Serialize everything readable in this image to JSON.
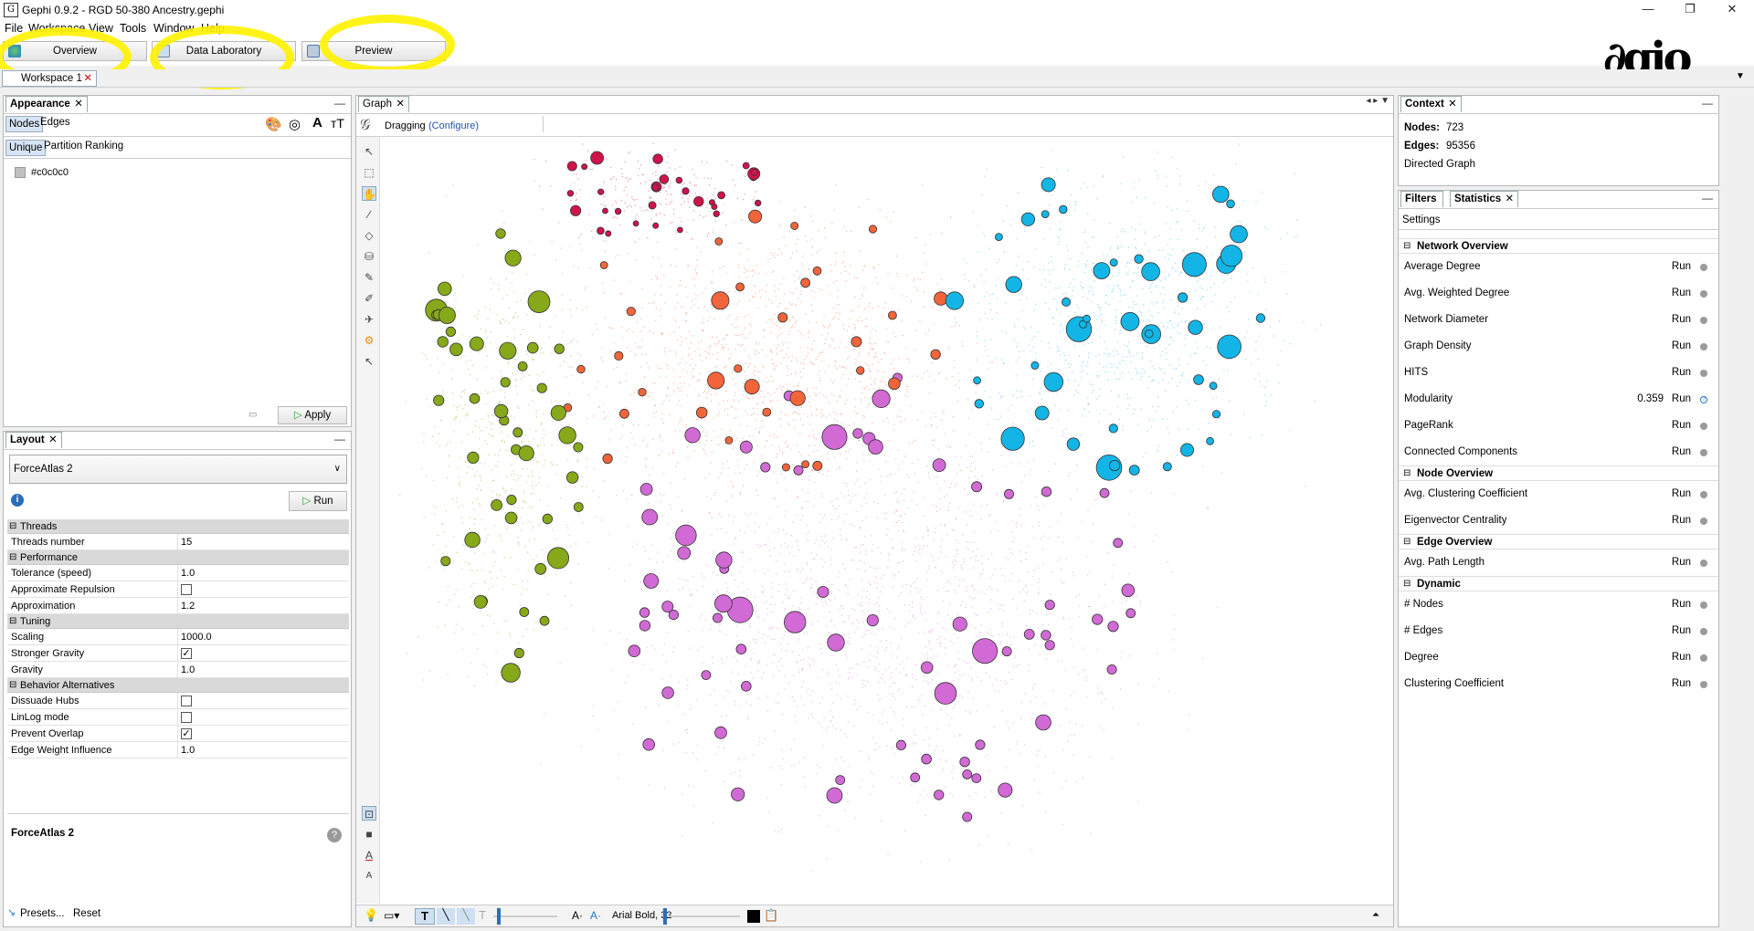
{
  "window": {
    "title": "Gephi 0.9.2 - RGD 50-380 Ancestry.gephi",
    "app_icon": "G",
    "controls": [
      "—",
      "❐",
      "✕"
    ]
  },
  "menu": [
    "File",
    "Workspace",
    "View",
    "Tools",
    "Window",
    "Help"
  ],
  "toolbar": {
    "overview": "Overview",
    "data_lab": "Data Laboratory",
    "preview": "Preview",
    "logo": "∂gio"
  },
  "workspace_tab": "Workspace 1",
  "appearance": {
    "tab": "Appearance",
    "subtabs": [
      "Nodes",
      "Edges"
    ],
    "modes": [
      "Unique",
      "Partition",
      "Ranking"
    ],
    "color_value": "#c0c0c0",
    "apply_label": "Apply",
    "icons": [
      "palette-icon",
      "size-icon",
      "label-color-icon",
      "label-size-icon"
    ]
  },
  "layout": {
    "tab": "Layout",
    "algorithm": "ForceAtlas 2",
    "run_label": "Run",
    "sections": [
      {
        "name": "Threads",
        "props": [
          {
            "name": "Threads number",
            "value": "15"
          }
        ]
      },
      {
        "name": "Performance",
        "props": [
          {
            "name": "Tolerance (speed)",
            "value": "1.0"
          },
          {
            "name": "Approximate Repulsion",
            "check": false
          },
          {
            "name": "Approximation",
            "value": "1.2"
          }
        ]
      },
      {
        "name": "Tuning",
        "props": [
          {
            "name": "Scaling",
            "value": "1000.0"
          },
          {
            "name": "Stronger Gravity",
            "check": true
          },
          {
            "name": "Gravity",
            "value": "1.0"
          }
        ]
      },
      {
        "name": "Behavior Alternatives",
        "props": [
          {
            "name": "Dissuade Hubs",
            "check": false
          },
          {
            "name": "LinLog mode",
            "check": false
          },
          {
            "name": "Prevent Overlap",
            "check": true
          },
          {
            "name": "Edge Weight Influence",
            "value": "1.0"
          }
        ]
      }
    ],
    "description_title": "ForceAtlas 2",
    "presets": "Presets...",
    "reset": "Reset"
  },
  "graph": {
    "tab": "Graph",
    "mode": "Dragging",
    "configure": "(Configure)",
    "font_label": "Arial Bold, 32",
    "colors": {
      "green": "#86a819",
      "red": "#d0134b",
      "orange": "#f2643a",
      "blue": "#12b5e6",
      "purple": "#d26ad6"
    }
  },
  "context": {
    "tab": "Context",
    "nodes_label": "Nodes:",
    "nodes": "723",
    "edges_label": "Edges:",
    "edges": "95356",
    "type": "Directed Graph"
  },
  "stats": {
    "tabs": [
      "Filters",
      "Statistics"
    ],
    "settings": "Settings",
    "run": "Run",
    "groups": [
      {
        "name": "Network Overview",
        "items": [
          {
            "name": "Average Degree"
          },
          {
            "name": "Avg. Weighted Degree"
          },
          {
            "name": "Network Diameter"
          },
          {
            "name": "Graph Density"
          },
          {
            "name": "HITS"
          },
          {
            "name": "Modularity",
            "value": "0.359"
          },
          {
            "name": "PageRank"
          },
          {
            "name": "Connected Components"
          }
        ]
      },
      {
        "name": "Node Overview",
        "items": [
          {
            "name": "Avg. Clustering Coefficient"
          },
          {
            "name": "Eigenvector Centrality"
          }
        ]
      },
      {
        "name": "Edge Overview",
        "items": [
          {
            "name": "Avg. Path Length"
          }
        ]
      },
      {
        "name": "Dynamic",
        "items": [
          {
            "name": "# Nodes"
          },
          {
            "name": "# Edges"
          },
          {
            "name": "Degree"
          },
          {
            "name": "Clustering Coefficient"
          }
        ]
      }
    ]
  }
}
